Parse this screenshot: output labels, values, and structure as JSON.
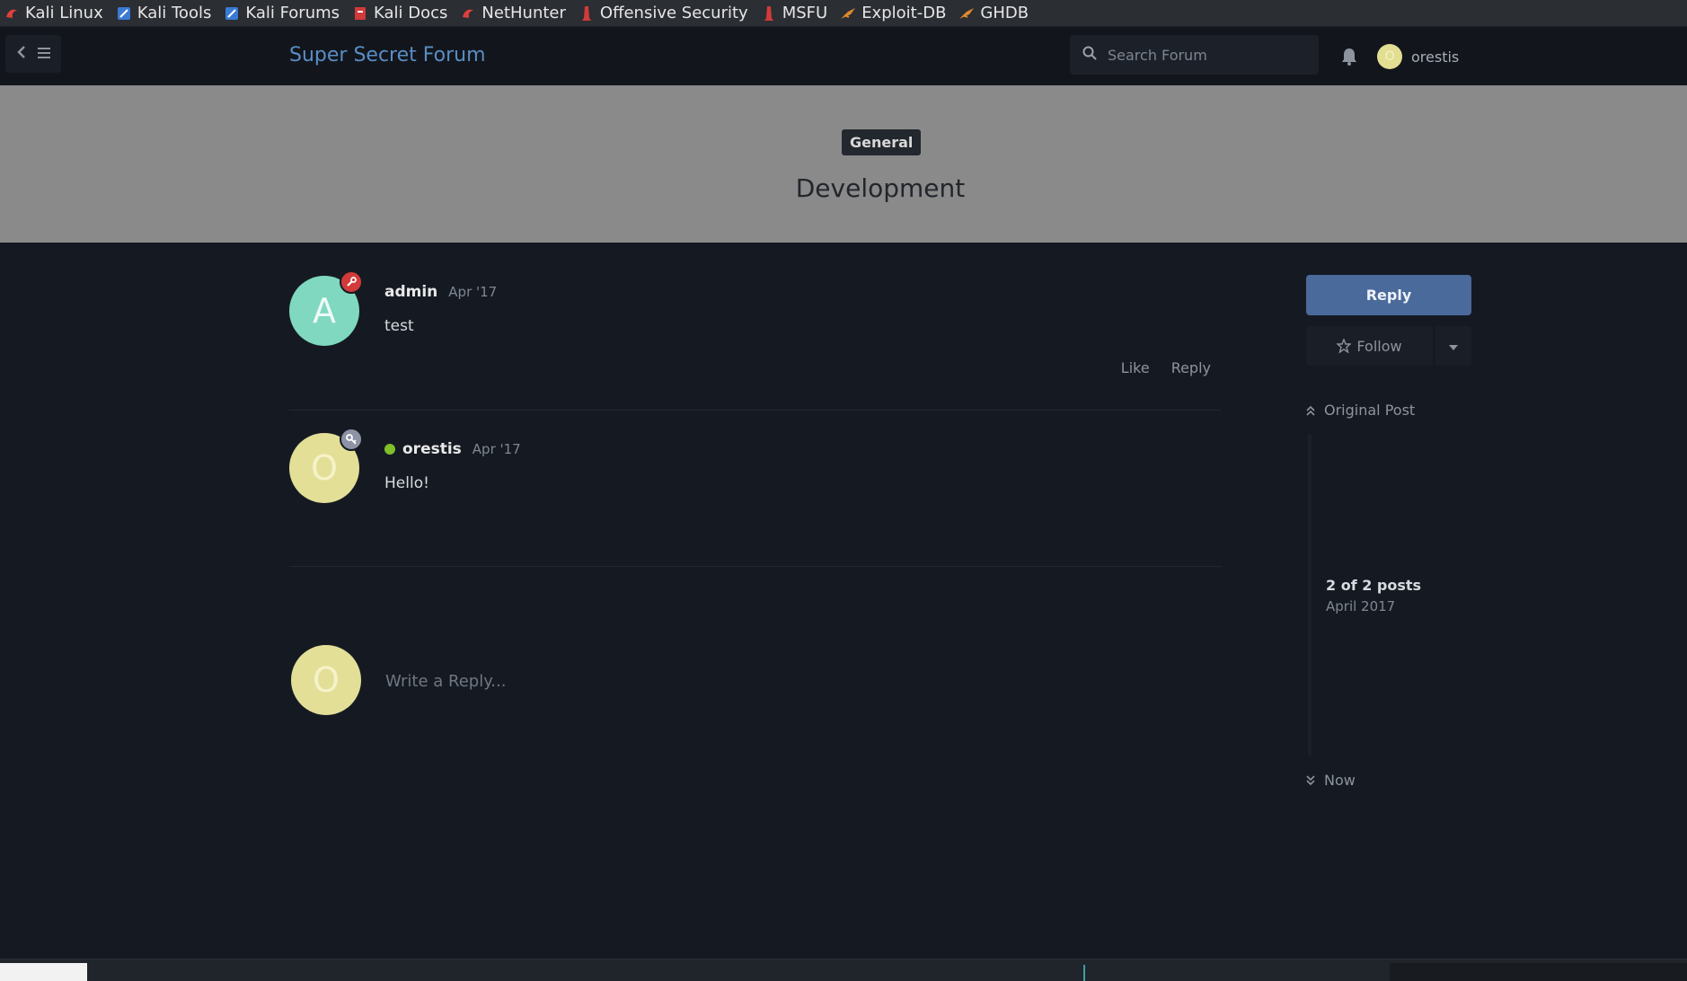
{
  "bookmarks": [
    {
      "label": "Kali Linux",
      "icon": "kali-dragon-icon",
      "color": "#e0403a"
    },
    {
      "label": "Kali Tools",
      "icon": "kali-tools-icon",
      "color": "#3a7bd5"
    },
    {
      "label": "Kali Forums",
      "icon": "kali-forums-icon",
      "color": "#3a7bd5"
    },
    {
      "label": "Kali Docs",
      "icon": "kali-docs-icon",
      "color": "#d13a3a"
    },
    {
      "label": "NetHunter",
      "icon": "kali-dragon-icon",
      "color": "#e0403a"
    },
    {
      "label": "Offensive Security",
      "icon": "offsec-icon",
      "color": "#d13a3a"
    },
    {
      "label": "MSFU",
      "icon": "offsec-icon",
      "color": "#d13a3a"
    },
    {
      "label": "Exploit-DB",
      "icon": "exploitdb-icon",
      "color": "#e08a2a"
    },
    {
      "label": "GHDB",
      "icon": "exploitdb-icon",
      "color": "#e08a2a"
    }
  ],
  "header": {
    "site_title": "Super Secret Forum",
    "search_placeholder": "Search Forum",
    "user_initial": "O",
    "username": "orestis"
  },
  "discussion": {
    "tag": "General",
    "title": "Development"
  },
  "posts": [
    {
      "avatar_initial": "A",
      "author": "admin",
      "date": "Apr '17",
      "body": "test",
      "badge": "wrench-icon",
      "online": false,
      "actions": [
        "Like",
        "Reply"
      ]
    },
    {
      "avatar_initial": "O",
      "author": "orestis",
      "date": "Apr '17",
      "body": "Hello!",
      "badge": "key-icon",
      "online": true,
      "actions": []
    }
  ],
  "reply_box": {
    "avatar_initial": "O",
    "placeholder": "Write a Reply..."
  },
  "sidebar": {
    "reply_label": "Reply",
    "follow_label": "Follow",
    "timeline_top": "Original Post",
    "timeline_count": "2 of 2 posts",
    "timeline_date": "April 2017",
    "timeline_bottom": "Now"
  },
  "colors": {
    "accent": "#4a6a9c",
    "site_title": "#5a8dc4",
    "background": "#151a22",
    "hero": "#8a8a8a"
  }
}
